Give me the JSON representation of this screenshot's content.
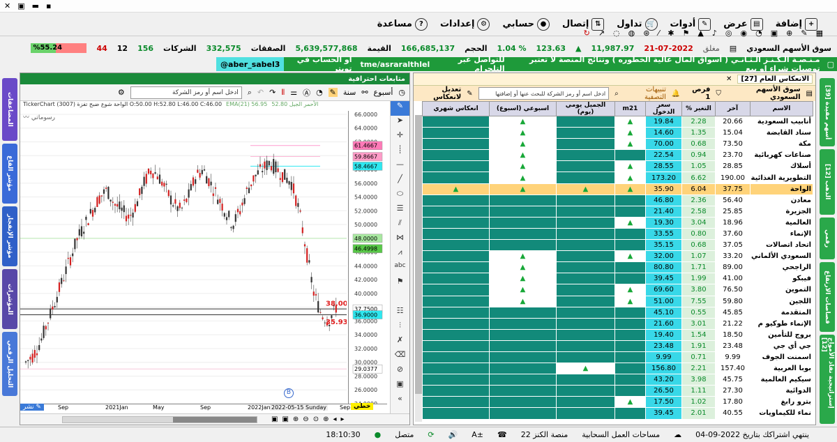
{
  "menu": {
    "help": "مساعدة",
    "settings": "إعدادات",
    "account": "حسابي",
    "connect": "إتصال",
    "trade": "تداول",
    "tools": "أدوات",
    "view": "عرض",
    "add": "إضافة"
  },
  "market": {
    "name": "سوق الأسهم السعودي",
    "date": "21-07-2022",
    "status": "مغلق",
    "index": "11,987.97",
    "change": "123.63",
    "pct": "% 1.04",
    "volume_label": "الحجم",
    "volume": "166,685,137",
    "value_label": "القيمة",
    "value": "5,639,577,868",
    "deals_label": "الصفقات",
    "deals": "332,575",
    "companies_label": "الشركات",
    "up": "156",
    "flat": "12",
    "down": "44",
    "ratio": "%55.24"
  },
  "ticker": {
    "msg1": "مـنـصـة الـكـنـز الـثـانـي ( أسواق المال عالية الخطوره ) وتتائج المنصة لا تعتبر توصيات شراء او بيع",
    "msg2": "للتواصل عبر التلجرام",
    "msg3": "tme/asraralthlel",
    "msg4": "او الحساب في تويتر",
    "msg5": "aber_sabel3@"
  },
  "left_tabs": [
    "المضاعفات",
    "مؤشر القاع",
    "مؤشر الإنفجار",
    "المؤشرات",
    "التحليل الرقمي"
  ],
  "right_tabs": [
    "أسهم مفيدة [39]",
    "الذهب [12]",
    "رقمي",
    "قصاصات الارتفاع",
    "إستراتيجية نفاذ الأمواج [12]"
  ],
  "chart": {
    "title": "متابعات احترافية",
    "period": "أسبوع",
    "label": "سنة",
    "search": "ادخل اسم أو رمز الشركة",
    "info": "TickerChart الواحة شوع ضبح تفزة (3007) O:50.00 H:52.80 L:46.00 C:46.00",
    "ema": "EMA(21) 56.95",
    "ind1": "الأحمر الجيل 52.80",
    "drawing": "رسوماتي",
    "xticks": [
      "Sep",
      "2021Jan",
      "May",
      "Sep",
      "2022Jan"
    ],
    "xcursor": "2022-05-15 Sunday",
    "xend": "Sep",
    "share": "نشر",
    "line_type": "خطي"
  },
  "chart_data": {
    "type": "candlestick",
    "yticks": [
      "66.0000",
      "64.0000",
      "62.0000",
      "60.0000",
      "58.0000",
      "56.0000",
      "54.0000",
      "52.0000",
      "50.0000",
      "48.0000",
      "46.0000",
      "44.0000",
      "42.0000",
      "40.0000",
      "38.0000",
      "36.0000",
      "34.0000",
      "32.0000",
      "30.0000",
      "28.0000",
      "26.0000",
      "24.0000"
    ],
    "ylim": [
      24,
      66.5
    ],
    "price_labels": [
      {
        "value": "61.4667",
        "color": "#ff7ab8"
      },
      {
        "value": "59.8667",
        "color": "#ff9cc8"
      },
      {
        "value": "58.4667",
        "color": "#2ee8f0"
      },
      {
        "value": "48.0000",
        "color": "#a8e8a0"
      },
      {
        "value": "46.4998",
        "color": "#58c848"
      },
      {
        "value": "37.7500",
        "color": "#ffffff"
      },
      {
        "value": "36.9000",
        "color": "#2ee8f0"
      },
      {
        "value": "29.0377",
        "color": "#ffffff"
      }
    ],
    "red_labels": [
      "38.00",
      "35.93"
    ]
  },
  "table": {
    "title": "الانعكاس العام [27]",
    "market": "سوق الأسهم السعودي",
    "chance": "فرص 1",
    "alerts": "تنبيهات التصفية",
    "search": "ادخل اسم أو رمز الشركة للبحث عنها أو إضافتها",
    "edit": "تعديل لانعكاس",
    "columns": [
      "الاسم",
      "آخر",
      "التغير %",
      "سعر الدخول",
      "m21",
      "الجميل يومي (يوم)",
      "اسبوعي (اسبوع)",
      "انعكاس شهري"
    ],
    "rows": [
      [
        "أنابيب السعودية",
        "20.66",
        "2.28",
        "19.84",
        1,
        0,
        1,
        0
      ],
      [
        "سناد القابضة",
        "15.04",
        "1.35",
        "14.60",
        1,
        0,
        1,
        0
      ],
      [
        "مكة",
        "73.50",
        "0.68",
        "70.00",
        1,
        0,
        1,
        0
      ],
      [
        "صناعات كهربائية",
        "23.70",
        "0.94",
        "22.54",
        0,
        0,
        1,
        0
      ],
      [
        "أسلاك",
        "28.85",
        "1.05",
        "28.55",
        1,
        0,
        1,
        0
      ],
      [
        "التطويرية الغذائية",
        "190.00",
        "6.62",
        "173.20",
        1,
        0,
        1,
        0
      ],
      [
        "الواحة",
        "37.75",
        "6.04",
        "35.90",
        1,
        1,
        1,
        1
      ],
      [
        "معادن",
        "56.40",
        "2.36",
        "46.80",
        0,
        0,
        0,
        0
      ],
      [
        "الجزيرة",
        "25.85",
        "2.58",
        "21.40",
        0,
        0,
        0,
        0
      ],
      [
        "العالمية",
        "18.96",
        "3.04",
        "19.30",
        1,
        0,
        0,
        0
      ],
      [
        "الإنماء",
        "37.60",
        "0.80",
        "33.55",
        0,
        0,
        0,
        0
      ],
      [
        "اتحاد اتصالات",
        "37.05",
        "0.68",
        "35.15",
        0,
        0,
        0,
        0
      ],
      [
        "السعودي الألماني ا",
        "33.20",
        "1.07",
        "32.00",
        1,
        0,
        1,
        0
      ],
      [
        "الراجحي",
        "89.00",
        "1.71",
        "80.80",
        0,
        0,
        1,
        0
      ],
      [
        "فيبكو",
        "41.00",
        "1.99",
        "39.45",
        0,
        0,
        1,
        0
      ],
      [
        "التموين",
        "76.50",
        "3.80",
        "69.60",
        1,
        0,
        1,
        0
      ],
      [
        "اللجين",
        "59.80",
        "7.55",
        "51.00",
        1,
        0,
        1,
        0
      ],
      [
        "المتقدمة",
        "45.85",
        "0.55",
        "45.10",
        0,
        0,
        0,
        0
      ],
      [
        "الإنماء طوكيو م",
        "21.22",
        "3.01",
        "21.60",
        0,
        0,
        0,
        0
      ],
      [
        "بروج للتأمين",
        "18.50",
        "1.54",
        "19.40",
        0,
        0,
        0,
        0
      ],
      [
        "جي أي جي",
        "23.48",
        "1.91",
        "23.48",
        0,
        0,
        0,
        0
      ],
      [
        "اسمنت الجوف",
        "9.99",
        "0.71",
        "9.99",
        0,
        0,
        0,
        0
      ],
      [
        "بوبا العربية",
        "157.40",
        "2.21",
        "156.80",
        0,
        1,
        0,
        0
      ],
      [
        "سيكيم العالمية",
        "45.75",
        "3.98",
        "43.20",
        0,
        0,
        0,
        0
      ],
      [
        "الدوائية",
        "27.30",
        "1.11",
        "26.50",
        0,
        0,
        0,
        0
      ],
      [
        "بترو رابغ",
        "17.80",
        "1.02",
        "17.50",
        1,
        0,
        0,
        0
      ],
      [
        "نماء للكيماويات",
        "40.55",
        "2.01",
        "39.45",
        0,
        0,
        0,
        0
      ]
    ]
  },
  "status": {
    "time": "18:10:30",
    "connected": "متصل",
    "platform": "منصة الكنز 22",
    "workspaces": "مساحات العمل السحابية",
    "subscription": "ينتهي اشتراكك بتاريخ 2022-09-04"
  }
}
